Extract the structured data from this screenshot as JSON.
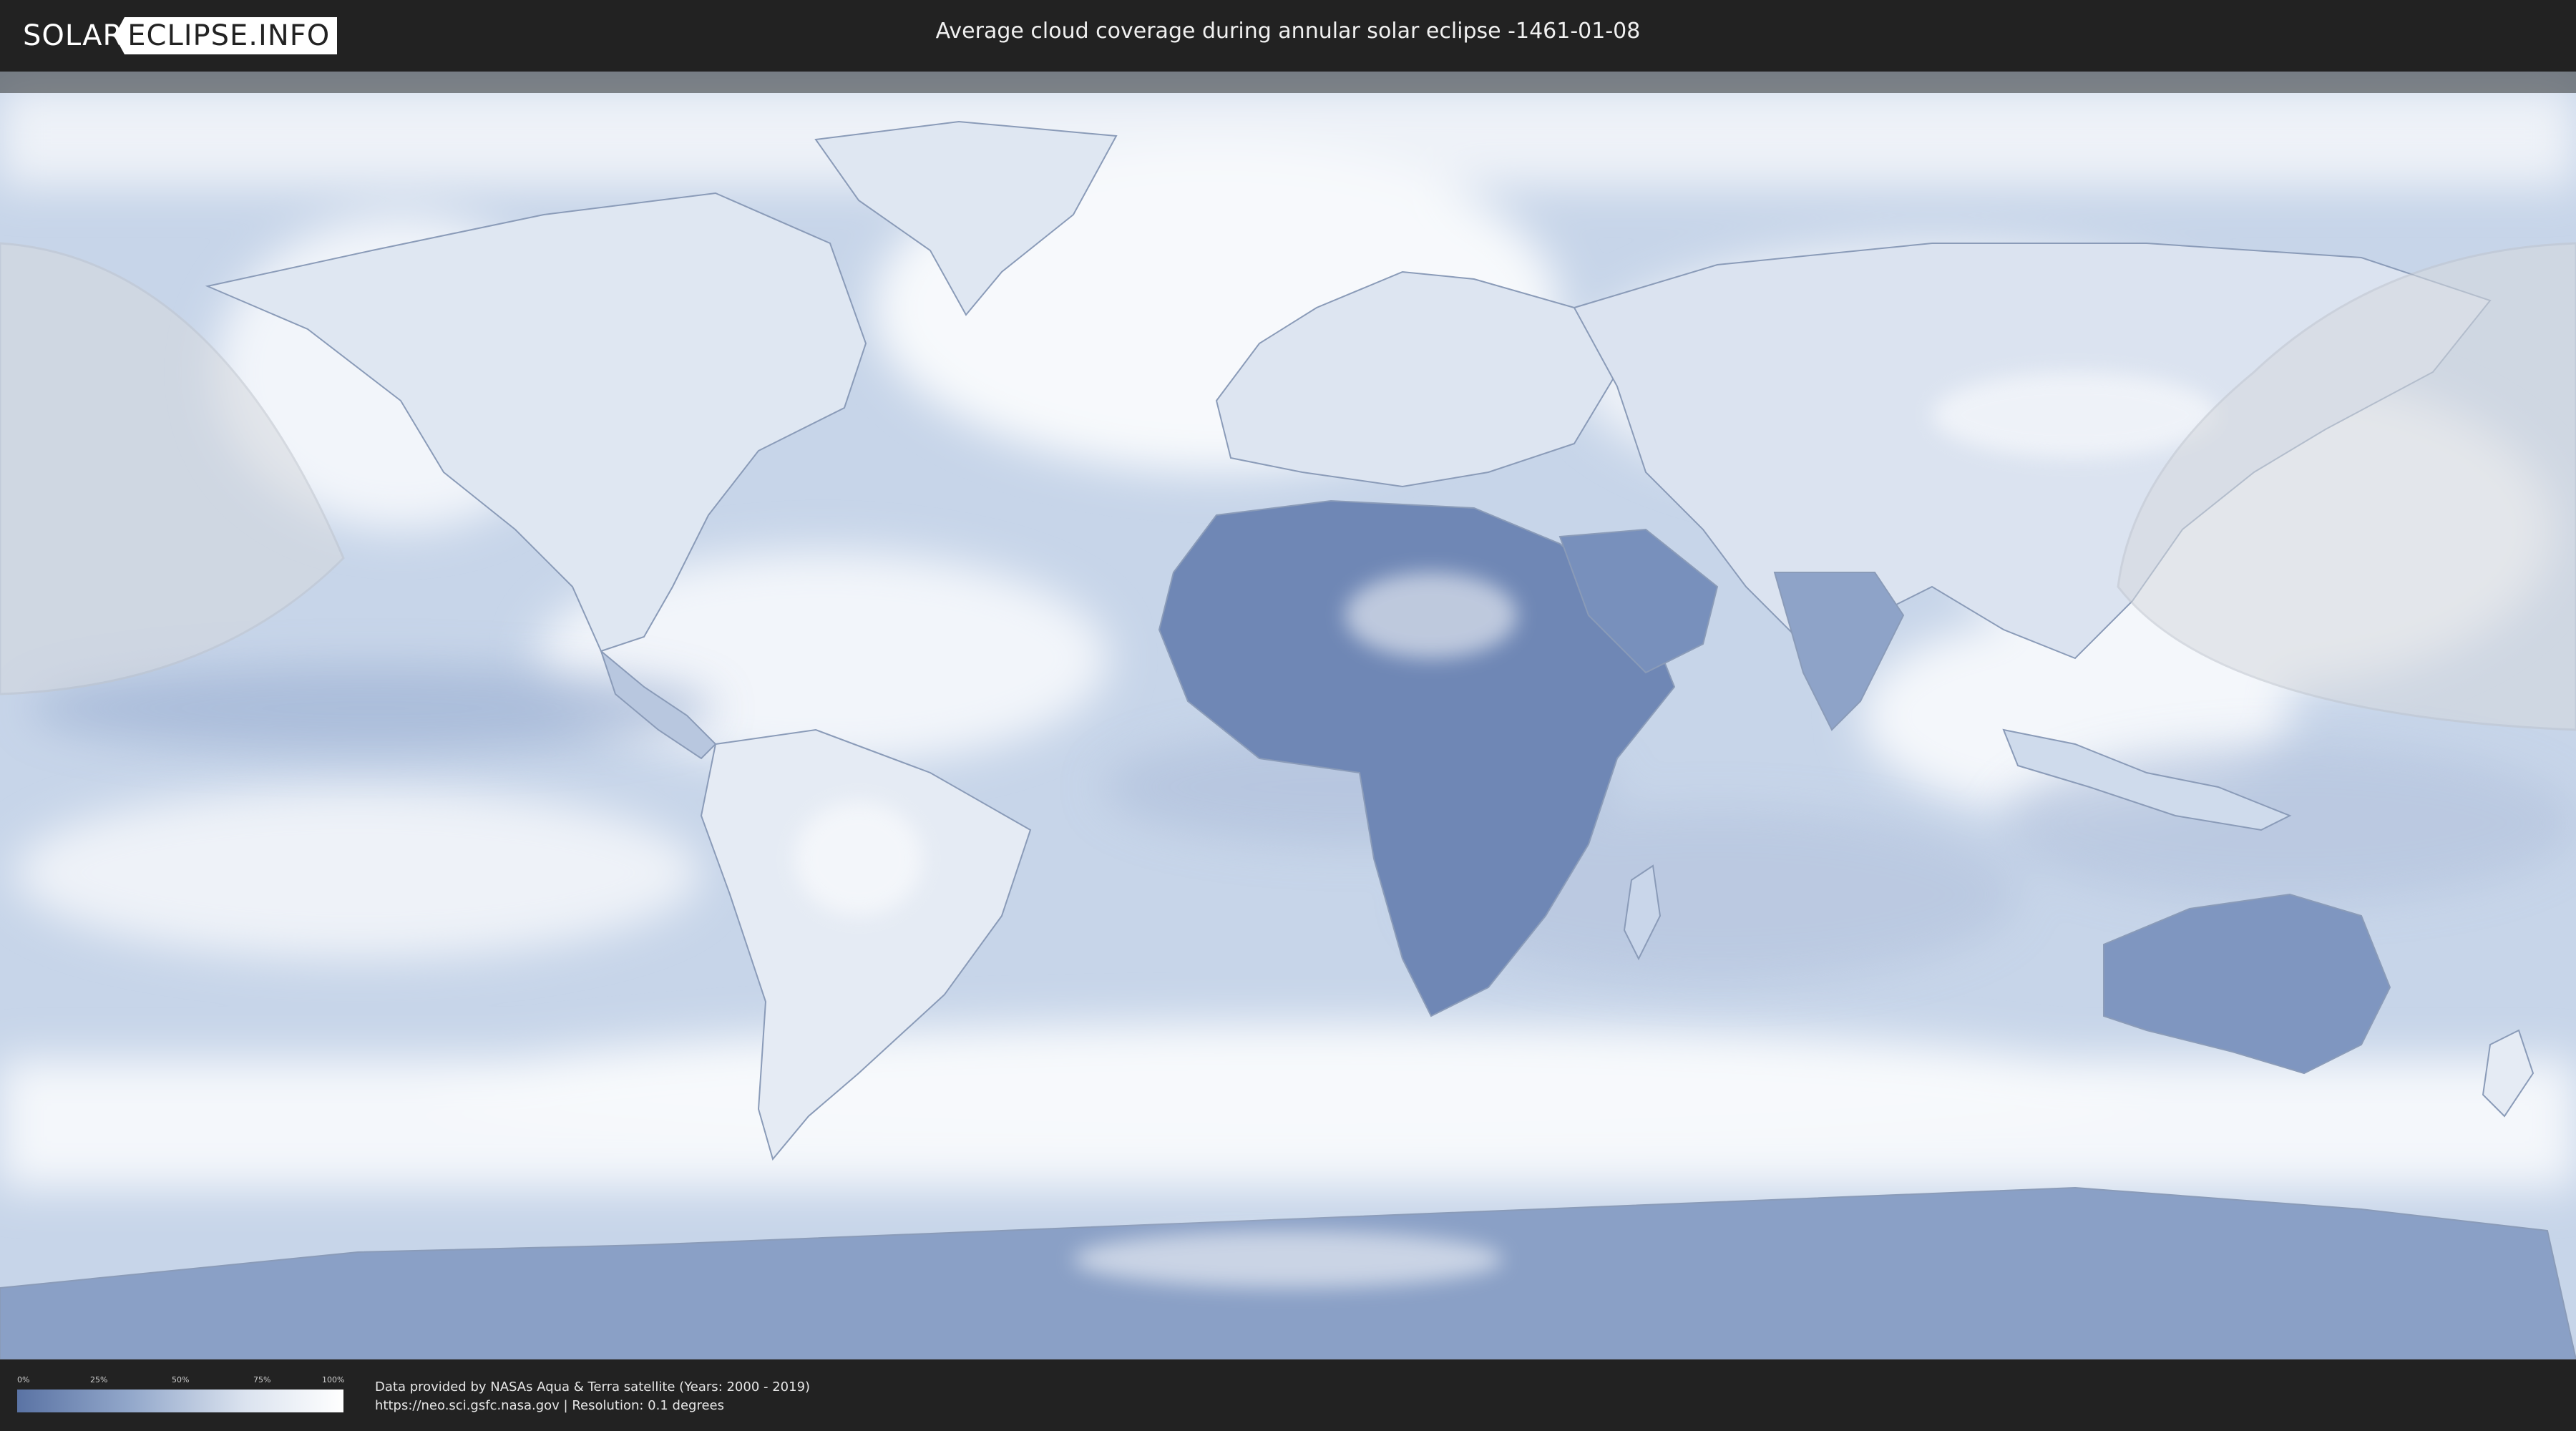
{
  "header": {
    "logo_part1": "SOLAR",
    "logo_part2": "ECLIPSE.INFO",
    "title": "Average cloud coverage during annular solar eclipse -1461-01-08"
  },
  "legend": {
    "ticks": [
      "0%",
      "25%",
      "50%",
      "75%",
      "100%"
    ],
    "colors": {
      "low": "#5a73a4",
      "high": "#ffffff"
    }
  },
  "credits": {
    "line1": "Data provided by NASAs Aqua & Terra satellite (Years: 2000 - 2019)",
    "line2": "https://neo.sci.gsfc.nasa.gov | Resolution: 0.1 degrees"
  },
  "map": {
    "type": "cloud-coverage-world-map",
    "projection": "equirectangular",
    "colors": {
      "ocean_clear": "#c9d7ea",
      "cloudy": "#f4f7fb",
      "land_clear": "#6f87b5",
      "eclipse_shade": "#d8dbe0"
    }
  }
}
